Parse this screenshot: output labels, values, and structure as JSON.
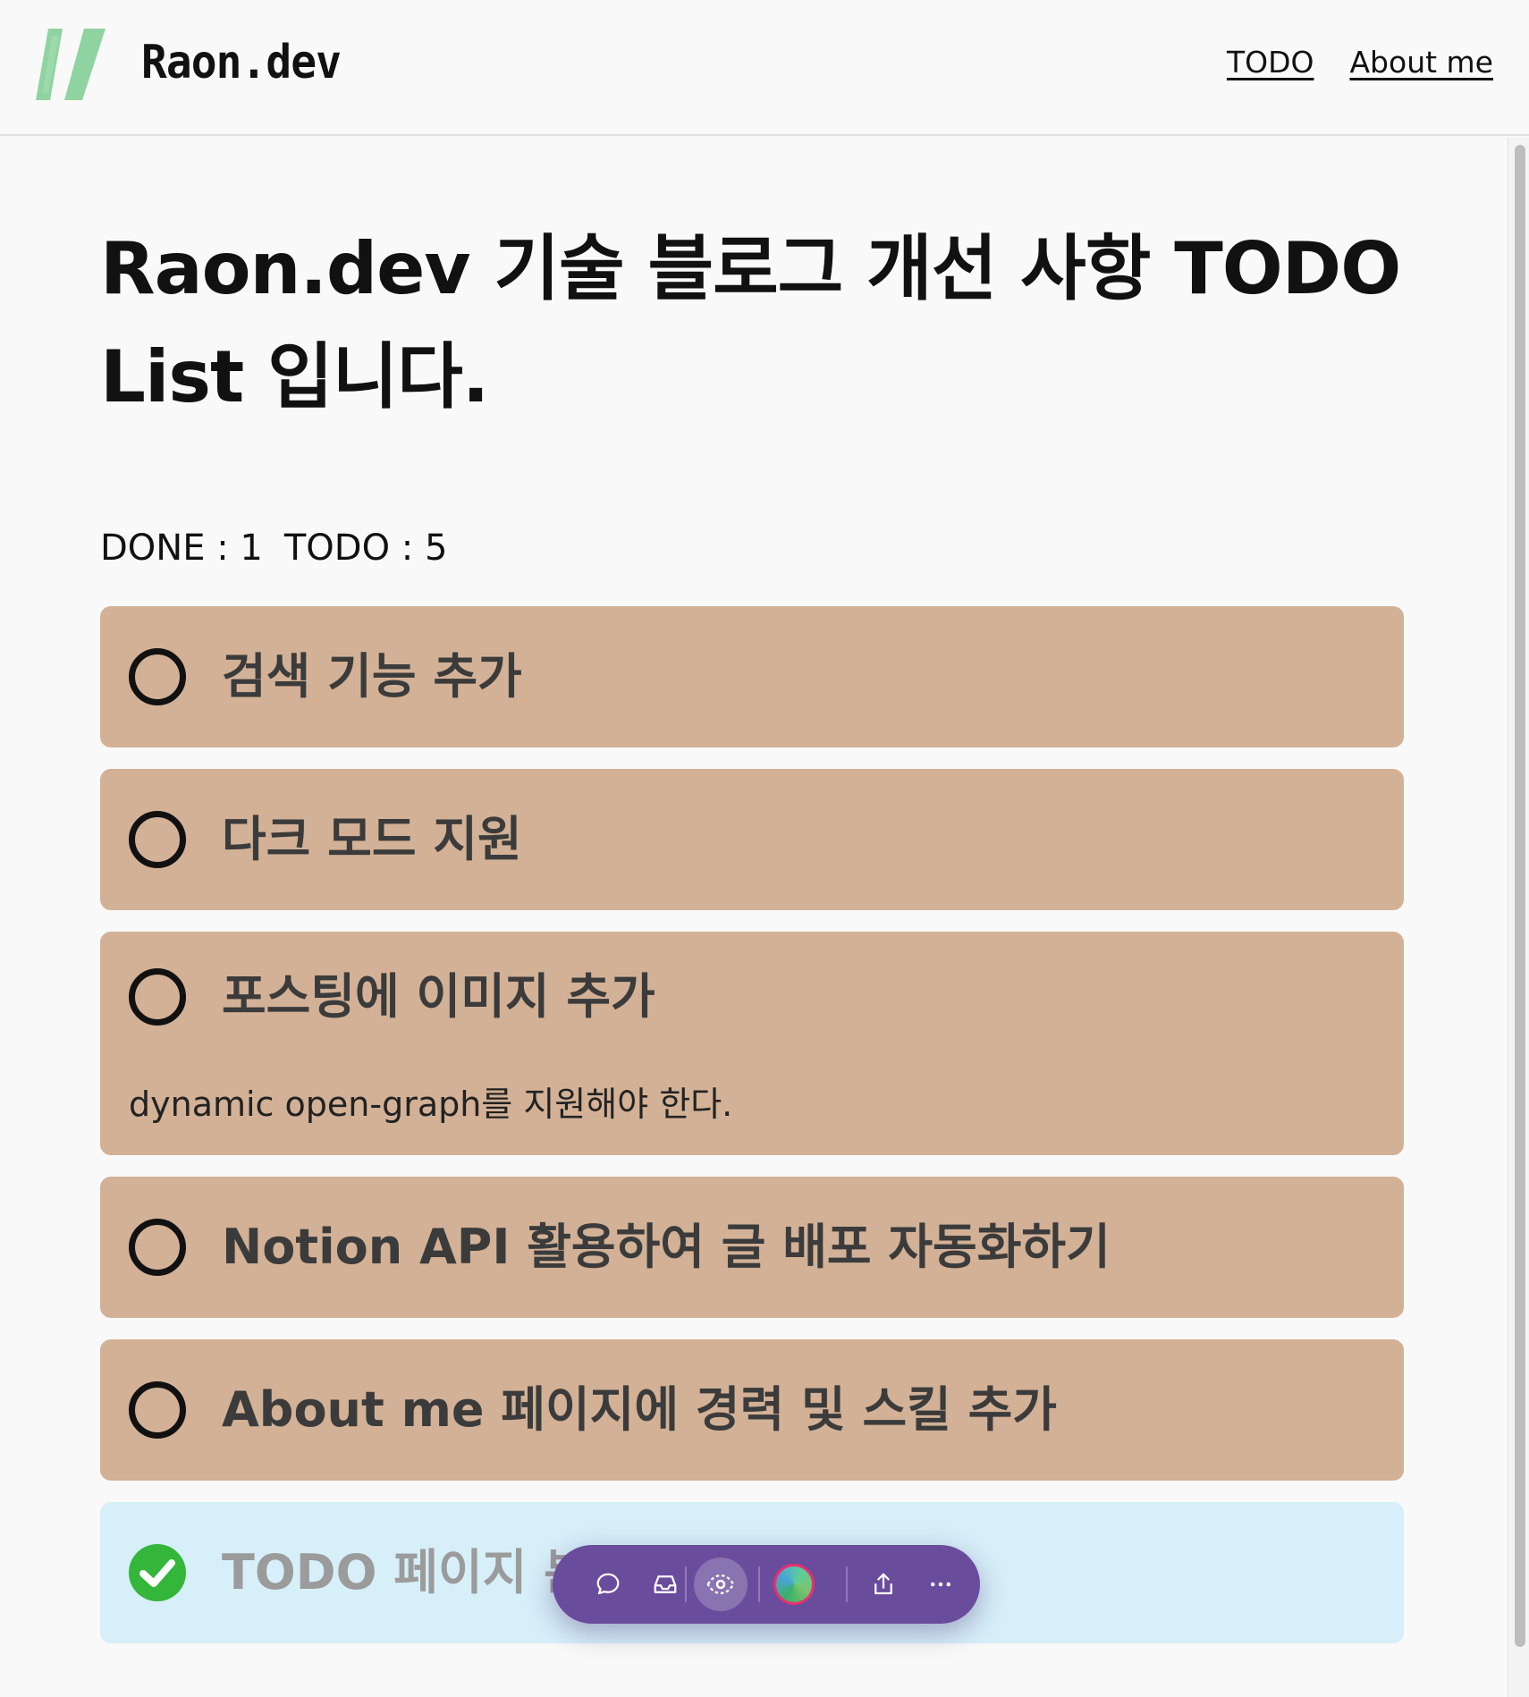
{
  "header": {
    "brand": "Raon.dev",
    "logo_icon": "slash-logo-icon",
    "nav": [
      {
        "label": "TODO"
      },
      {
        "label": "About me"
      }
    ]
  },
  "main": {
    "title_line1": "Raon.dev 기술 블로그 개선 사항 TODO",
    "title_line2": "List 입니다.",
    "counts": {
      "done_label": "DONE : 1",
      "todo_label": "TODO : 5"
    },
    "items": [
      {
        "title": "검색 기능 추가",
        "description": "",
        "done": false,
        "icon": "empty-circle-icon"
      },
      {
        "title": "다크 모드 지원",
        "description": "",
        "done": false,
        "icon": "empty-circle-icon"
      },
      {
        "title": "포스팅에 이미지 추가",
        "description": "dynamic open-graph를 지원해야 한다.",
        "done": false,
        "icon": "empty-circle-icon"
      },
      {
        "title": "Notion API 활용하여 글 배포 자동화하기",
        "description": "",
        "done": false,
        "icon": "empty-circle-icon"
      },
      {
        "title": "About me 페이지에 경력 및 스킬 추가",
        "description": "",
        "done": false,
        "icon": "empty-circle-icon"
      },
      {
        "title": "TODO 페이지 분",
        "description": "",
        "done": true,
        "icon": "check-circle-icon"
      }
    ]
  },
  "colors": {
    "todo_item_bg": "#d2b196",
    "done_item_bg": "#d6eff9",
    "check_green": "#34b63a",
    "logo_green": "#8fd4a0",
    "toolbar_bg": "#6a4c9c"
  },
  "toolbar": {
    "icons": [
      "comment-icon",
      "inbox-icon",
      "eye-icon",
      "avatar",
      "share-icon",
      "more-icon"
    ]
  }
}
